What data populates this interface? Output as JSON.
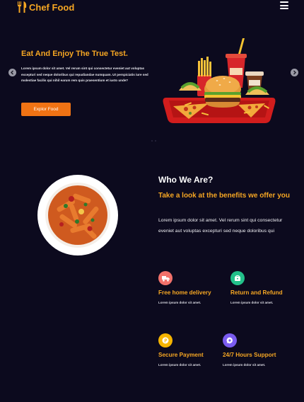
{
  "header": {
    "brand": "Chef Food",
    "brand_icon": "fork-knife-icon",
    "menu_icon": "hamburger-menu-icon",
    "brand_color": "#f5a623"
  },
  "hero": {
    "title": "Eat And Enjoy The True Test.",
    "text": "Lorem ipsum dolor sit amet. Vel rerum sint qui consectetur eveniet aut voluptas excepturi sed neque doloribus qui repudiandae numquam. Ut perspiciatis iure sed molestiae facilis qui nihil earum rem quis praesentium et iusto unde?",
    "button_label": "Explor Food",
    "prev_icon": "chevron-left-icon",
    "next_icon": "chevron-right-icon",
    "button_color": "#f07314"
  },
  "about": {
    "heading": "Who We Are?",
    "subheading": "Take a look at the benefits we offer you",
    "text": "Lorem ipsum dolor sit amet. Vel rerum sint qui consectetur eveniet aut voluptas excepturi sed neque doloribus qui"
  },
  "features": [
    {
      "icon": "truck-icon",
      "color": "#f2716b",
      "title": "Free home delivery",
      "text": "Lorem ipsum dolor sit amet."
    },
    {
      "icon": "return-box-icon",
      "color": "#23c08a",
      "title": "Return and Refund",
      "text": "Lorem ipsum dolor sit amet."
    },
    {
      "icon": "payment-icon",
      "color": "#f5b400",
      "title": "Secure Payment",
      "text": "Lorem ipsum dolor sit amet."
    },
    {
      "icon": "support-chat-icon",
      "color": "#7a5cf0",
      "title": "24/7 Hours Support",
      "text": "Lorem ipsum dolor sit amet."
    }
  ]
}
